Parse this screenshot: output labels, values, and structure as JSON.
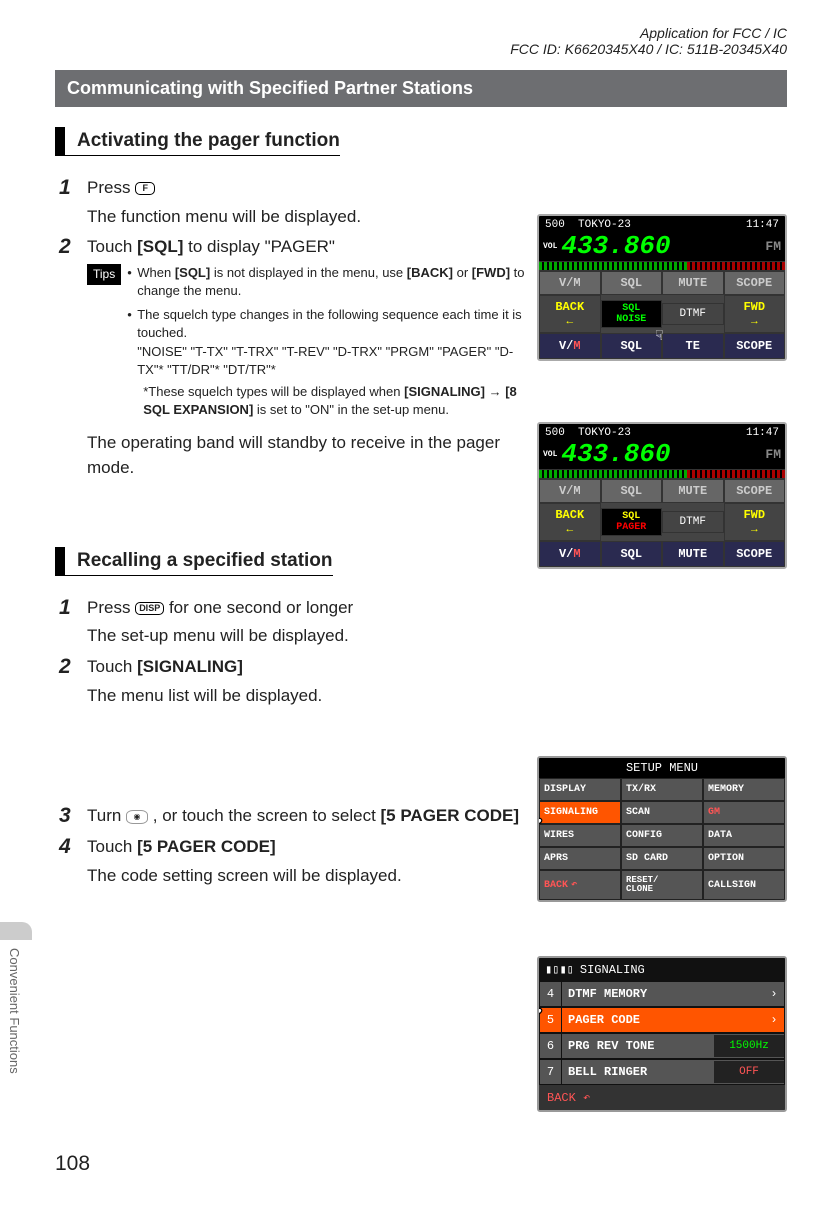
{
  "header": {
    "line1": "Application for FCC / IC",
    "line2": "FCC ID: K6620345X40 / IC: 511B-20345X40"
  },
  "main_bar": "Communicating with Specified Partner Stations",
  "section1": {
    "heading": "Activating the pager function",
    "step1_prefix": "Press ",
    "step1_key": "F",
    "step1_line2": "The function menu will be displayed.",
    "step2_prefix": "Touch ",
    "step2_bold": "[SQL]",
    "step2_suffix": " to display \"PAGER\"",
    "tips_label": "Tips",
    "tip1_a": "When ",
    "tip1_b": "[SQL]",
    "tip1_c": " is not displayed in the menu, use ",
    "tip1_d": "[BACK]",
    "tip1_e": " or ",
    "tip1_f": "[FWD]",
    "tip1_g": " to change the menu.",
    "tip2_a": "The squelch type changes in the following sequence each time it is touched.",
    "tip2_b": "\"NOISE\" \"T-TX\" \"T-TRX\" \"T-REV\" \"D-TRX\" \"PRGM\" \"PAGER\" \"D-TX\"* \"TT/DR\"* \"DT/TR\"*",
    "tip2_c": "*These squelch types will be displayed when ",
    "tip2_d": "[SIGNALING] → [8 SQL EXPANSION]",
    "tip2_e": " is set to \"ON\" in the set-up menu.",
    "result": "The operating band will standby to receive in the pager mode."
  },
  "section2": {
    "heading": "Recalling a specified station",
    "step1_prefix": "Press ",
    "step1_key": "DISP",
    "step1_suffix": " for one second or longer",
    "step1_line2": "The set-up menu will be displayed.",
    "step2_prefix": "Touch ",
    "step2_bold": "[SIGNALING]",
    "step2_line2": "The menu list will be displayed.",
    "step3_prefix": "Turn ",
    "step3_dial": "DIAL",
    "step3_suffix": ", or touch the screen to select ",
    "step3_bold": "[5 PAGER CODE]",
    "step4_prefix": "Touch ",
    "step4_bold": "[5 PAGER CODE]",
    "step4_line2": "The code setting screen will be displayed."
  },
  "screens": {
    "common": {
      "ch": "500",
      "loc": "TOKYO-23",
      "time": "11:47",
      "vol": "VOL",
      "freq": "433.860",
      "mode": "FM",
      "vm": "V/M",
      "sql": "SQL",
      "mute": "MUTE",
      "scope": "SCOPE",
      "back": "BACK",
      "dtmf": "DTMF",
      "fwd": "FWD",
      "te": "TE"
    },
    "sql1_top": "SQL",
    "sql1_bot": "NOISE",
    "sql2_top": "SQL",
    "sql2_bot": "PAGER"
  },
  "setup": {
    "title": "SETUP MENU",
    "cells": [
      "DISPLAY",
      "TX/RX",
      "MEMORY",
      "SIGNALING",
      "SCAN",
      "GM",
      "WIRES",
      "CONFIG",
      "DATA",
      "APRS",
      "SD CARD",
      "OPTION",
      "BACK",
      "RESET/\nCLONE",
      "CALLSIGN"
    ]
  },
  "signaling": {
    "title": "SIGNALING",
    "rows": [
      {
        "n": "4",
        "label": "DTMF MEMORY",
        "val": "",
        "chev": "›"
      },
      {
        "n": "5",
        "label": "PAGER CODE",
        "val": "",
        "chev": "›",
        "hl": true
      },
      {
        "n": "6",
        "label": "PRG REV TONE",
        "val": "1500Hz"
      },
      {
        "n": "7",
        "label": "BELL RINGER",
        "val": "OFF",
        "off": true
      }
    ],
    "back": "BACK"
  },
  "side_tab": "Convenient Functions",
  "page_number": "108"
}
